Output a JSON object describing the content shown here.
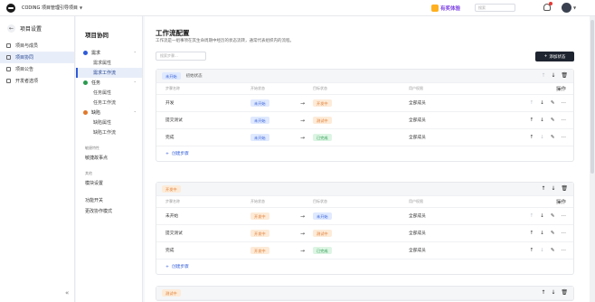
{
  "topbar": {
    "project_name": "CODING 项目管理引导项目",
    "promo_label": "有奖体验",
    "search_placeholder": "搜索"
  },
  "sidebar": {
    "title": "项目设置",
    "items": [
      {
        "label": "项目与成员",
        "active": false
      },
      {
        "label": "项目协同",
        "active": true
      },
      {
        "label": "项目公告",
        "active": false
      },
      {
        "label": "开发者选项",
        "active": false
      }
    ]
  },
  "subnav": {
    "title": "项目协同",
    "groups": [
      {
        "label": "需求",
        "color": "#2f5bd8",
        "subs": [
          {
            "label": "需求属性",
            "active": false
          },
          {
            "label": "需求工作流",
            "active": true
          }
        ]
      },
      {
        "label": "任务",
        "color": "#2a9a4f",
        "subs": [
          {
            "label": "任务属性",
            "active": false
          },
          {
            "label": "任务工作流",
            "active": false
          }
        ]
      },
      {
        "label": "缺陷",
        "color": "#e0782a",
        "subs": [
          {
            "label": "缺陷属性",
            "active": false
          },
          {
            "label": "缺陷工作流",
            "active": false
          }
        ]
      }
    ],
    "section_agile": "敏捷特性",
    "agile_item": "敏捷故事点",
    "section_other": "其他",
    "other_item": "模块设置",
    "switch_label": "功能开关",
    "mode_label": "更改协作模式"
  },
  "main": {
    "title": "工作流配置",
    "description": "工作流是一组事项在其生命周期中经历的状态流转，通常代表组织内的流程。",
    "search_placeholder": "搜索步骤...",
    "add_status_label": "添加状态",
    "columns": [
      "步骤名称",
      "开始状态",
      "",
      "目标状态",
      "用户权限",
      "操作"
    ],
    "add_step_label": "创建步骤",
    "cards": [
      {
        "status": "未开始",
        "status_color": "blue",
        "note": "初始状态",
        "rows": [
          {
            "name": "开发",
            "from": "未开始",
            "from_color": "blue",
            "to": "开发中",
            "to_color": "orange",
            "perm": "全部成员"
          },
          {
            "name": "提交测试",
            "from": "未开始",
            "from_color": "blue",
            "to": "测试中",
            "to_color": "orange",
            "perm": "全部成员"
          },
          {
            "name": "完成",
            "from": "未开始",
            "from_color": "blue",
            "to": "已完成",
            "to_color": "green",
            "perm": "全部成员"
          }
        ]
      },
      {
        "status": "开发中",
        "status_color": "orange",
        "note": "",
        "rows": [
          {
            "name": "未开始",
            "from": "开发中",
            "from_color": "orange",
            "to": "未开始",
            "to_color": "blue",
            "perm": "全部成员"
          },
          {
            "name": "提交测试",
            "from": "开发中",
            "from_color": "orange",
            "to": "测试中",
            "to_color": "orange",
            "perm": "全部成员"
          },
          {
            "name": "完成",
            "from": "开发中",
            "from_color": "orange",
            "to": "已完成",
            "to_color": "green",
            "perm": "全部成员"
          }
        ]
      },
      {
        "status": "测试中",
        "status_color": "orange",
        "note": "",
        "rows": []
      }
    ]
  },
  "icons": {
    "arrow": "→",
    "up": "↑",
    "down": "↓",
    "edit": "✎",
    "more": "⋯",
    "trash": "🗑",
    "plus": "+"
  }
}
